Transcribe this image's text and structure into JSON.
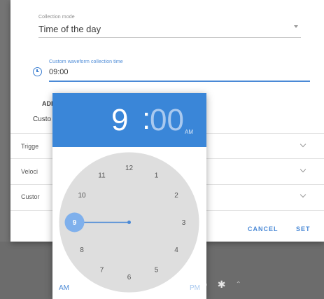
{
  "collection_mode": {
    "label": "Collection mode",
    "value": "Time of the day"
  },
  "custom_time": {
    "label": "Custom waveform collection time",
    "value": "09:00"
  },
  "sections": {
    "advanced_partial": "ADI",
    "custom_partial": "Custo"
  },
  "rows": [
    {
      "label": "Trigge"
    },
    {
      "label": "Veloci"
    },
    {
      "label": "Custor"
    }
  ],
  "actions": {
    "cancel": "CANCEL",
    "set": "SET"
  },
  "time_picker": {
    "hour": "9",
    "colon": ":",
    "minutes": "00",
    "period": "AM",
    "am_label": "AM",
    "pm_label": "PM",
    "selected_hour": 9,
    "dial_numbers": [
      "12",
      "1",
      "2",
      "3",
      "4",
      "5",
      "6",
      "7",
      "8",
      "9",
      "10",
      "11"
    ],
    "accent_color": "#3a86d8"
  },
  "taskbar_icons": [
    "settings-circle-icon",
    "gear-icon",
    "chevron-up-icon"
  ]
}
